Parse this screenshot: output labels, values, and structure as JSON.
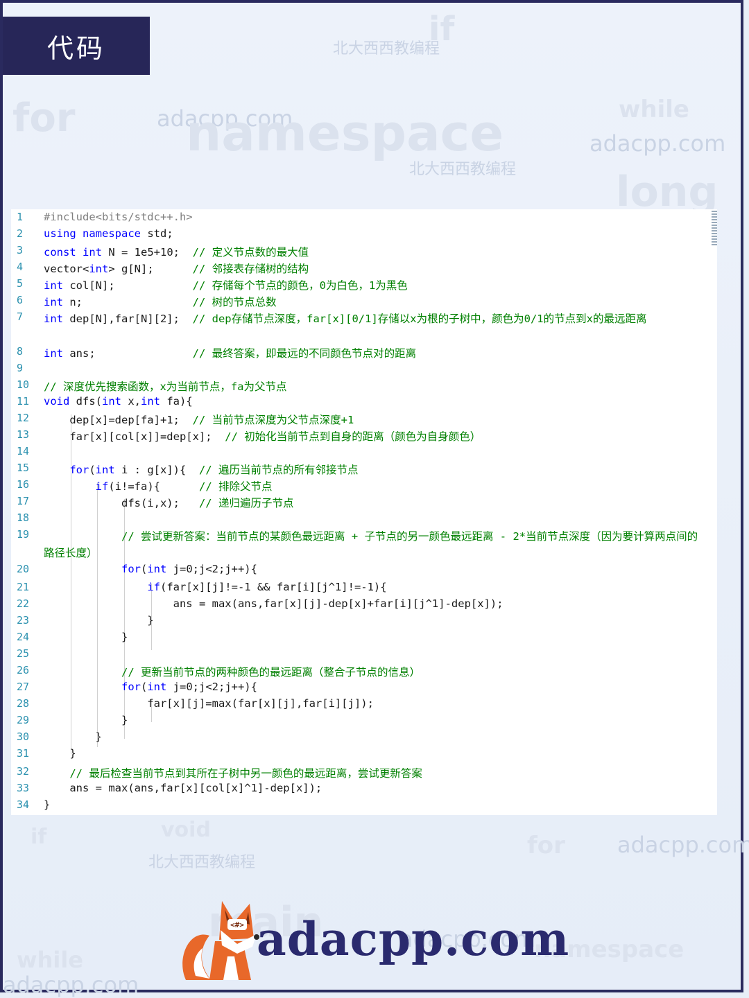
{
  "title": "代码",
  "watermarks": {
    "brand_cn": "北大西西教编程",
    "brand_url": "adacpp.com",
    "keywords": [
      "if",
      "for",
      "while",
      "long",
      "namespace",
      "&&",
      "void",
      "main",
      "namespace",
      "while",
      "if",
      "for"
    ]
  },
  "code_lines": [
    {
      "ln": "1",
      "text": "#include<bits/stdc++.h>"
    },
    {
      "ln": "2",
      "text": "using namespace std;"
    },
    {
      "ln": "3",
      "text": "const int N = 1e5+10;  // 定义节点数的最大值"
    },
    {
      "ln": "4",
      "text": "vector<int> g[N];      // 邻接表存储树的结构"
    },
    {
      "ln": "5",
      "text": "int col[N];            // 存储每个节点的颜色，0为白色，1为黑色"
    },
    {
      "ln": "6",
      "text": "int n;                 // 树的节点总数"
    },
    {
      "ln": "7",
      "text": "int dep[N],far[N][2];  // dep存储节点深度，far[x][0/1]存储以x为根的子树中，颜色为0/1的节点到x的最远距离"
    },
    {
      "ln": "8",
      "text": "int ans;               // 最终答案，即最远的不同颜色节点对的距离"
    },
    {
      "ln": "9",
      "text": ""
    },
    {
      "ln": "10",
      "text": "// 深度优先搜索函数，x为当前节点，fa为父节点"
    },
    {
      "ln": "11",
      "text": "void dfs(int x,int fa){"
    },
    {
      "ln": "12",
      "text": "    dep[x]=dep[fa]+1;  // 当前节点深度为父节点深度+1"
    },
    {
      "ln": "13",
      "text": "    far[x][col[x]]=dep[x];  // 初始化当前节点到自身的距离（颜色为自身颜色）"
    },
    {
      "ln": "14",
      "text": ""
    },
    {
      "ln": "15",
      "text": "    for(int i : g[x]){  // 遍历当前节点的所有邻接节点"
    },
    {
      "ln": "16",
      "text": "        if(i!=fa){      // 排除父节点"
    },
    {
      "ln": "17",
      "text": "            dfs(i,x);   // 递归遍历子节点"
    },
    {
      "ln": "18",
      "text": ""
    },
    {
      "ln": "19",
      "text": "            // 尝试更新答案：当前节点的某颜色最远距离 + 子节点的另一颜色最远距离 - 2*当前节点深度（因为要计算两点间的路径长度）"
    },
    {
      "ln": "20",
      "text": "            for(int j=0;j<2;j++){"
    },
    {
      "ln": "21",
      "text": "                if(far[x][j]!=-1 && far[i][j^1]!=-1){"
    },
    {
      "ln": "22",
      "text": "                    ans = max(ans,far[x][j]-dep[x]+far[i][j^1]-dep[x]);"
    },
    {
      "ln": "23",
      "text": "                }"
    },
    {
      "ln": "24",
      "text": "            }"
    },
    {
      "ln": "25",
      "text": ""
    },
    {
      "ln": "26",
      "text": "            // 更新当前节点的两种颜色的最远距离（整合子节点的信息）"
    },
    {
      "ln": "27",
      "text": "            for(int j=0;j<2;j++){"
    },
    {
      "ln": "28",
      "text": "                far[x][j]=max(far[x][j],far[i][j]);"
    },
    {
      "ln": "29",
      "text": "            }"
    },
    {
      "ln": "30",
      "text": "        }"
    },
    {
      "ln": "31",
      "text": "    }"
    },
    {
      "ln": "32",
      "text": "    // 最后检查当前节点到其所在子树中另一颜色的最远距离，尝试更新答案"
    },
    {
      "ln": "33",
      "text": "    ans = max(ans,far[x][col[x]^1]-dep[x]);"
    },
    {
      "ln": "34",
      "text": "}"
    }
  ],
  "logo": {
    "text": "adacpp.com",
    "badge": "<#>"
  },
  "colors": {
    "title_bg": "#272658",
    "keyword": "#0000ff",
    "comment": "#008000",
    "line_number": "#2b91af",
    "logo": "#2a2a6e",
    "fox": "#e8682a"
  }
}
